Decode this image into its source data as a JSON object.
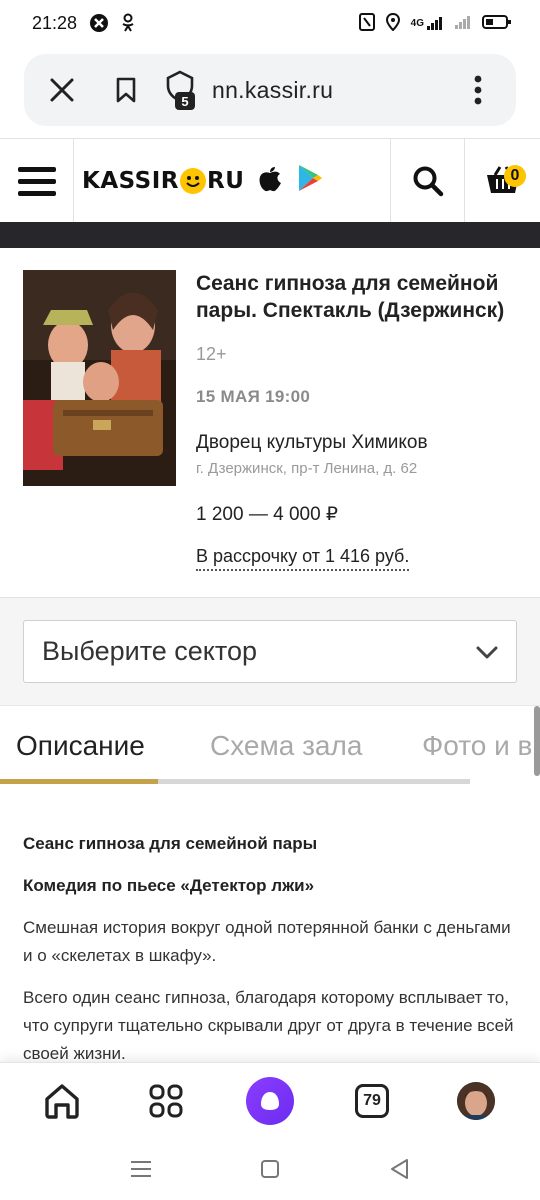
{
  "status_bar": {
    "time": "21:28",
    "network": "4G"
  },
  "browser": {
    "url": "nn.kassir.ru",
    "tab_count": "5"
  },
  "site": {
    "logo_left": "KASSIR",
    "logo_right": "RU",
    "cart_count": "0"
  },
  "event": {
    "title": "Сеанс гипноза для семейной пары. Спектакль (Дзержинск)",
    "age": "12+",
    "date": "15 МАЯ 19:00",
    "venue": "Дворец культуры Химиков",
    "address": "г. Дзержинск, пр-т Ленина, д. 62",
    "price": "1 200 — 4 000 ₽",
    "installment": "В рассрочку от 1 416 руб."
  },
  "sector": {
    "placeholder": "Выберите сектор"
  },
  "tabs": [
    {
      "label": "Описание"
    },
    {
      "label": "Схема зала"
    },
    {
      "label": "Фото и в"
    }
  ],
  "description": {
    "heading": "Сеанс гипноза для семейной пары",
    "subheading": "Комедия по пьесе «Детектор лжи»",
    "paragraphs": [
      "Смешная история вокруг одной потерянной банки с деньгами и о «скелетах в шкафу».",
      "Всего один сеанс гипноза, благодаря которому всплывает то, что супруги тщательно скрывали друг от друга в течение всей своей жизни."
    ]
  },
  "bottom_nav": {
    "tabs_count": "79"
  },
  "colors": {
    "accent_gold": "#c4a24a",
    "logo_yellow": "#ffc400",
    "alice_purple": "#7b34f5",
    "dark_strip": "#27272b"
  }
}
